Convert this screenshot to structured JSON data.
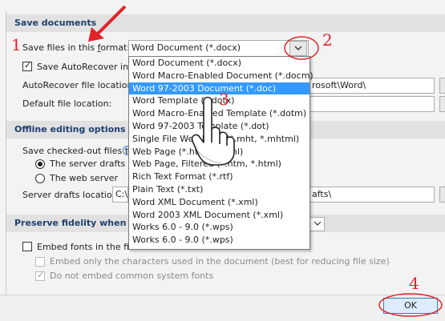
{
  "save_documents": {
    "section_title": "Save documents",
    "format_label_pre": "Save files in this ",
    "format_label_ul": "f",
    "format_label_post": "ormat:",
    "format_value": "Word Document (*.docx)",
    "autorecover_label": "Save AutoRecover infor",
    "autorecover_checked": true,
    "autorecover_location_label": "AutoRecover file location:",
    "autorecover_location_value": "rosoft\\Word\\",
    "default_location_label": "Default file location:"
  },
  "dropdown": {
    "items": [
      "Word Document (*.docx)",
      "Word Macro-Enabled Document (*.docm)",
      "Word 97-2003 Document (*.doc)",
      "Word Template (*.dotx)",
      "Word Macro-Enabled Template (*.dotm)",
      "Word 97-2003 Template (*.dot)",
      "Single File Web Page (*.mht, *.mhtml)",
      "Web Page (*.htm, *.html)",
      "Web Page, Filtered (*.htm, *.html)",
      "Rich Text Format (*.rtf)",
      "Plain Text (*.txt)",
      "Word XML Document (*.xml)",
      "Word 2003 XML Document (*.xml)",
      "Works 6.0 - 9.0 (*.wps)",
      "Works 6.0 - 9.0 (*.wps)"
    ],
    "selected_index": 2
  },
  "offline": {
    "section_title": "Offline editing options for do",
    "save_checked_out_label": "Save checked-out files to:",
    "server_drafts_option": "The server drafts loca",
    "web_server_option": "The web server",
    "server_drafts_location_label": "Server drafts location:",
    "server_drafts_location_value_left": "C:\\",
    "server_drafts_location_value_right": "afts\\"
  },
  "fidelity": {
    "section_title": "Preserve fidelity when sharin",
    "embed_fonts_label": "Embed fonts in the file",
    "embed_only_used_label": "Embed only the characters used in the document (best for reducing file size)",
    "do_not_embed_system_label": "Do not embed common system fonts"
  },
  "footer": {
    "ok_label": "OK"
  },
  "annotations": {
    "step1": "1",
    "step2": "2",
    "step3": "3",
    "step4": "4",
    "color": "#e0242a"
  },
  "icons": [
    "chevron-down-icon",
    "info-icon",
    "red-arrow-icon",
    "hand-pointer-icon"
  ]
}
